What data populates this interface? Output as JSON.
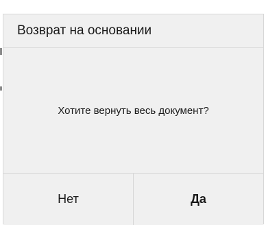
{
  "dialog": {
    "title": "Возврат на основании",
    "message": "Хотите вернуть весь документ?",
    "buttons": {
      "no_label": "Нет",
      "yes_label": "Да"
    }
  },
  "colors": {
    "dialog_background": "#f0f0f0",
    "border": "#d7d7d7",
    "text": "#1a1a1a"
  }
}
